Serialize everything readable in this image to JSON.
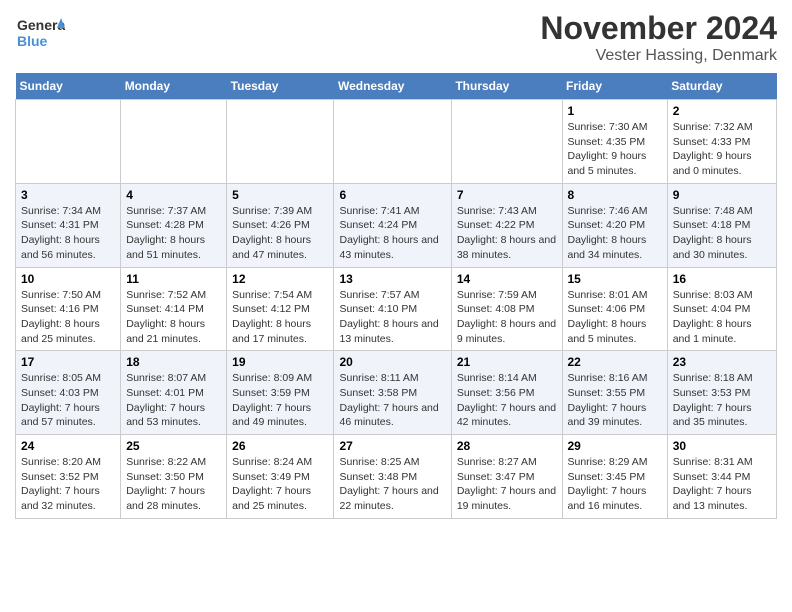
{
  "logo": {
    "general": "General",
    "blue": "Blue"
  },
  "title": "November 2024",
  "subtitle": "Vester Hassing, Denmark",
  "days_of_week": [
    "Sunday",
    "Monday",
    "Tuesday",
    "Wednesday",
    "Thursday",
    "Friday",
    "Saturday"
  ],
  "weeks": [
    [
      {
        "day": "",
        "info": ""
      },
      {
        "day": "",
        "info": ""
      },
      {
        "day": "",
        "info": ""
      },
      {
        "day": "",
        "info": ""
      },
      {
        "day": "",
        "info": ""
      },
      {
        "day": "1",
        "info": "Sunrise: 7:30 AM\nSunset: 4:35 PM\nDaylight: 9 hours and 5 minutes."
      },
      {
        "day": "2",
        "info": "Sunrise: 7:32 AM\nSunset: 4:33 PM\nDaylight: 9 hours and 0 minutes."
      }
    ],
    [
      {
        "day": "3",
        "info": "Sunrise: 7:34 AM\nSunset: 4:31 PM\nDaylight: 8 hours and 56 minutes."
      },
      {
        "day": "4",
        "info": "Sunrise: 7:37 AM\nSunset: 4:28 PM\nDaylight: 8 hours and 51 minutes."
      },
      {
        "day": "5",
        "info": "Sunrise: 7:39 AM\nSunset: 4:26 PM\nDaylight: 8 hours and 47 minutes."
      },
      {
        "day": "6",
        "info": "Sunrise: 7:41 AM\nSunset: 4:24 PM\nDaylight: 8 hours and 43 minutes."
      },
      {
        "day": "7",
        "info": "Sunrise: 7:43 AM\nSunset: 4:22 PM\nDaylight: 8 hours and 38 minutes."
      },
      {
        "day": "8",
        "info": "Sunrise: 7:46 AM\nSunset: 4:20 PM\nDaylight: 8 hours and 34 minutes."
      },
      {
        "day": "9",
        "info": "Sunrise: 7:48 AM\nSunset: 4:18 PM\nDaylight: 8 hours and 30 minutes."
      }
    ],
    [
      {
        "day": "10",
        "info": "Sunrise: 7:50 AM\nSunset: 4:16 PM\nDaylight: 8 hours and 25 minutes."
      },
      {
        "day": "11",
        "info": "Sunrise: 7:52 AM\nSunset: 4:14 PM\nDaylight: 8 hours and 21 minutes."
      },
      {
        "day": "12",
        "info": "Sunrise: 7:54 AM\nSunset: 4:12 PM\nDaylight: 8 hours and 17 minutes."
      },
      {
        "day": "13",
        "info": "Sunrise: 7:57 AM\nSunset: 4:10 PM\nDaylight: 8 hours and 13 minutes."
      },
      {
        "day": "14",
        "info": "Sunrise: 7:59 AM\nSunset: 4:08 PM\nDaylight: 8 hours and 9 minutes."
      },
      {
        "day": "15",
        "info": "Sunrise: 8:01 AM\nSunset: 4:06 PM\nDaylight: 8 hours and 5 minutes."
      },
      {
        "day": "16",
        "info": "Sunrise: 8:03 AM\nSunset: 4:04 PM\nDaylight: 8 hours and 1 minute."
      }
    ],
    [
      {
        "day": "17",
        "info": "Sunrise: 8:05 AM\nSunset: 4:03 PM\nDaylight: 7 hours and 57 minutes."
      },
      {
        "day": "18",
        "info": "Sunrise: 8:07 AM\nSunset: 4:01 PM\nDaylight: 7 hours and 53 minutes."
      },
      {
        "day": "19",
        "info": "Sunrise: 8:09 AM\nSunset: 3:59 PM\nDaylight: 7 hours and 49 minutes."
      },
      {
        "day": "20",
        "info": "Sunrise: 8:11 AM\nSunset: 3:58 PM\nDaylight: 7 hours and 46 minutes."
      },
      {
        "day": "21",
        "info": "Sunrise: 8:14 AM\nSunset: 3:56 PM\nDaylight: 7 hours and 42 minutes."
      },
      {
        "day": "22",
        "info": "Sunrise: 8:16 AM\nSunset: 3:55 PM\nDaylight: 7 hours and 39 minutes."
      },
      {
        "day": "23",
        "info": "Sunrise: 8:18 AM\nSunset: 3:53 PM\nDaylight: 7 hours and 35 minutes."
      }
    ],
    [
      {
        "day": "24",
        "info": "Sunrise: 8:20 AM\nSunset: 3:52 PM\nDaylight: 7 hours and 32 minutes."
      },
      {
        "day": "25",
        "info": "Sunrise: 8:22 AM\nSunset: 3:50 PM\nDaylight: 7 hours and 28 minutes."
      },
      {
        "day": "26",
        "info": "Sunrise: 8:24 AM\nSunset: 3:49 PM\nDaylight: 7 hours and 25 minutes."
      },
      {
        "day": "27",
        "info": "Sunrise: 8:25 AM\nSunset: 3:48 PM\nDaylight: 7 hours and 22 minutes."
      },
      {
        "day": "28",
        "info": "Sunrise: 8:27 AM\nSunset: 3:47 PM\nDaylight: 7 hours and 19 minutes."
      },
      {
        "day": "29",
        "info": "Sunrise: 8:29 AM\nSunset: 3:45 PM\nDaylight: 7 hours and 16 minutes."
      },
      {
        "day": "30",
        "info": "Sunrise: 8:31 AM\nSunset: 3:44 PM\nDaylight: 7 hours and 13 minutes."
      }
    ]
  ]
}
